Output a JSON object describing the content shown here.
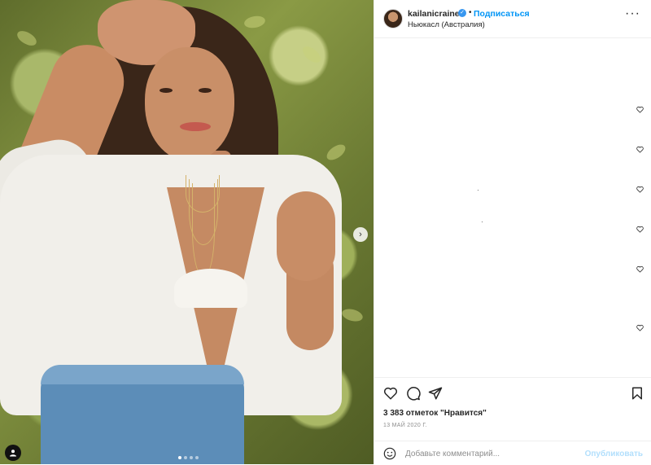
{
  "post": {
    "username": "kailanicraine",
    "verified_icon": "verified-badge-icon",
    "separator": "•",
    "follow_label": "Подписаться",
    "location": "Ньюкасл (Австралия)",
    "more_icon": "more-options-icon",
    "more_glyph": "···"
  },
  "media": {
    "carousel_total": 4,
    "carousel_active": 1,
    "next_glyph": "›",
    "next_icon": "chevron-right-icon",
    "tag_icon": "user-tag-icon"
  },
  "actions": {
    "like_icon": "heart-icon",
    "comment_icon": "comment-icon",
    "share_icon": "paper-plane-icon",
    "save_icon": "bookmark-icon"
  },
  "likes_text": "3 383 отметок \"Нравится\"",
  "date_text": "13 МАЙ 2020 Г.",
  "comment_box": {
    "placeholder": "Добавьте комментарий...",
    "publish_label": "Опубликовать",
    "emoji_icon": "emoji-icon"
  },
  "colors": {
    "accent": "#0095f6",
    "publish_disabled": "#b2dffc",
    "text": "#262626",
    "secondary": "#8e8e8e"
  }
}
